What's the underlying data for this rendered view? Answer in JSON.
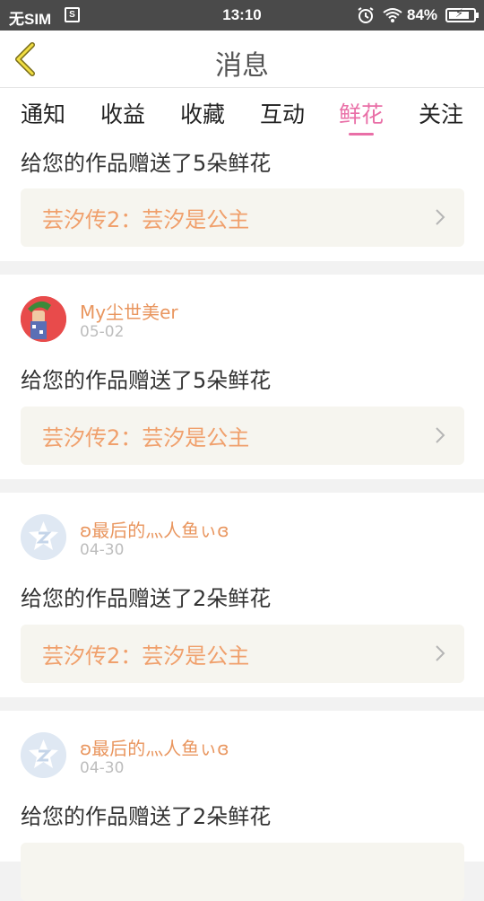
{
  "status_bar": {
    "carrier": "无SIM",
    "sim_icon": "S",
    "time": "13:10",
    "battery": "84%",
    "battery_level": 0.84,
    "icons": [
      "sim-icon",
      "alarm-icon",
      "wifi-icon",
      "battery-icon"
    ]
  },
  "header": {
    "back_icon": "chevron-left-icon",
    "title": "消息"
  },
  "tabs": [
    {
      "label": "通知"
    },
    {
      "label": "收益"
    },
    {
      "label": "收藏"
    },
    {
      "label": "互动"
    },
    {
      "label": "鲜花"
    },
    {
      "label": "关注"
    }
  ],
  "active_tab": "鲜花",
  "accent_color": "#e96fa7",
  "messages": [
    {
      "text": "给您的作品赠送了5朵鲜花",
      "work": "芸汐传2：芸汐是公主"
    },
    {
      "user": "My尘世美er",
      "date": "05-02",
      "avatar": "photo",
      "text": "给您的作品赠送了5朵鲜花",
      "work": "芸汐传2：芸汐是公主"
    },
    {
      "user": "ʚ最后的灬人鱼ぃɞ",
      "date": "04-30",
      "avatar": "default",
      "text": "给您的作品赠送了2朵鲜花",
      "work": "芸汐传2：芸汐是公主"
    },
    {
      "user": "ʚ最后的灬人鱼ぃɞ",
      "date": "04-30",
      "avatar": "default",
      "text": "给您的作品赠送了2朵鲜花",
      "work": ""
    }
  ]
}
